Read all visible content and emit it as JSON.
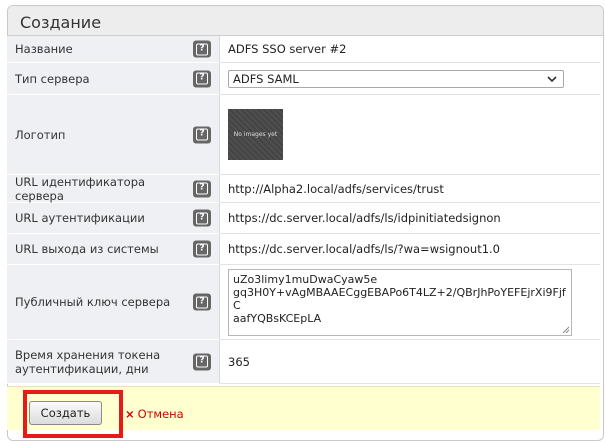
{
  "form": {
    "title": "Создание",
    "rows": [
      {
        "label": "Название",
        "value": "ADFS SSO server #2"
      },
      {
        "label": "Тип сервера",
        "value": "ADFS SAML"
      },
      {
        "label": "Логотип",
        "logo_text": "No images yet"
      },
      {
        "label": "URL идентификатора сервера",
        "value": "http://Alpha2.local/adfs/services/trust"
      },
      {
        "label": "URL аутентификации",
        "value": "https://dc.server.local/adfs/ls/idpinitiatedsignon"
      },
      {
        "label": "URL выхода из системы",
        "value": "https://dc.server.local/adfs/ls/?wa=wsignout1.0"
      },
      {
        "label": "Публичный ключ сервера",
        "value": "uZo3limy1muDwaCyaw5e\ngq3H0Y+vAgMBAAECggEBAPo6T4LZ+2/QBrJhPoYEFEjrXi9FjfC\naafYQBsKCEpLA"
      },
      {
        "label": "Время хранения токена аутентификации, дни",
        "value": "365"
      }
    ],
    "help_glyph": "?"
  },
  "footer": {
    "submit_label": "Создать",
    "cancel_label": "Отмена",
    "cancel_glyph": "×"
  },
  "icons": {
    "help": "help-icon",
    "dropdown": "chevron-down-icon",
    "cancel": "close-icon",
    "resize": "resize-grip-icon"
  },
  "colors": {
    "label_bg": "#eef0f3",
    "footer_bg": "#ffffcf",
    "cancel": "#d40000",
    "highlight": "#e41b17"
  }
}
